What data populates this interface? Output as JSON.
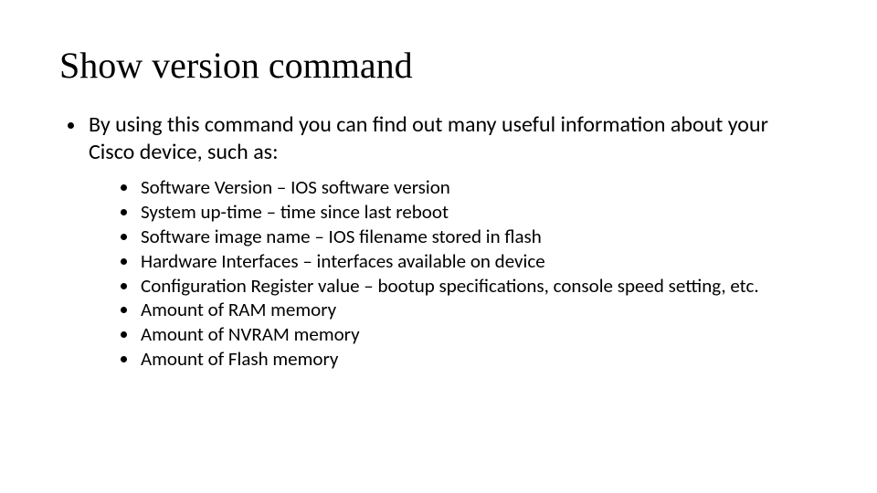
{
  "title": "Show version command",
  "intro": "By using this command you can find out many useful information about your Cisco device, such as:",
  "sub_items": [
    "Software Version – IOS software version",
    "System up-time – time since last reboot",
    "Software image name – IOS filename stored in flash",
    "Hardware Interfaces – interfaces available on device",
    "Configuration Register value – bootup specifications, console speed setting, etc.",
    "Amount of RAM memory",
    "Amount of NVRAM memory",
    "Amount of Flash memory"
  ]
}
